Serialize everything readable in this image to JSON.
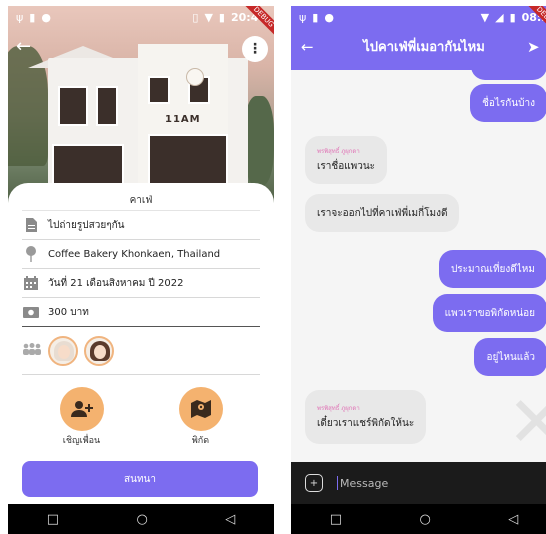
{
  "status_left": {
    "time": "20:46"
  },
  "status_right": {
    "time": "08:2"
  },
  "debug_label": "DEBUG",
  "place": {
    "category": "คาเฟ่",
    "note": "ไปถ่ายรูปสวยๆกัน",
    "location": "Coffee Bakery Khonkaen, Thailand",
    "date": "วันที่ 21 เดือนสิงหาคม ปี 2022",
    "price": "300 บาท",
    "invite_label": "เชิญเพื่อน",
    "map_label": "พิกัด",
    "chat_button": "สนทนา"
  },
  "hero": {
    "sign": "11AM"
  },
  "chat": {
    "title": "ไปคาเฟ่พี่เมอากันไหม",
    "messages": [
      {
        "from": "me",
        "text": "ชื่อไรกันบ้าง"
      },
      {
        "from": "them",
        "sender": "พรพิสุทธิ์ ภูผุกดา",
        "text": "เราชื่อแพวนะ"
      },
      {
        "from": "them",
        "text": "เราจะออกไปที่คาเฟ่พี่เมกี่โมงดี"
      },
      {
        "from": "me",
        "text": "ประมาณเที่ยงดีไหม"
      },
      {
        "from": "me",
        "text": "แพวเราขอพิกัดหน่อย"
      },
      {
        "from": "me",
        "text": "อยู่ไหนแล้ว"
      },
      {
        "from": "them",
        "sender": "พรพิสุทธิ์ ภูผุกดา",
        "text": "เดี๋ยวเราแชร์พิกัดให้นะ"
      }
    ],
    "placeholder": "Message"
  },
  "colors": {
    "accent": "#7c6cf0",
    "orange": "#f4b26f",
    "sender": "#e077b7"
  },
  "icons": [
    "back-arrow-icon",
    "more-vert-icon",
    "document-icon",
    "pin-icon",
    "calendar-icon",
    "money-icon",
    "group-icon",
    "add-person-icon",
    "map-icon",
    "send-icon",
    "attach-icon"
  ]
}
